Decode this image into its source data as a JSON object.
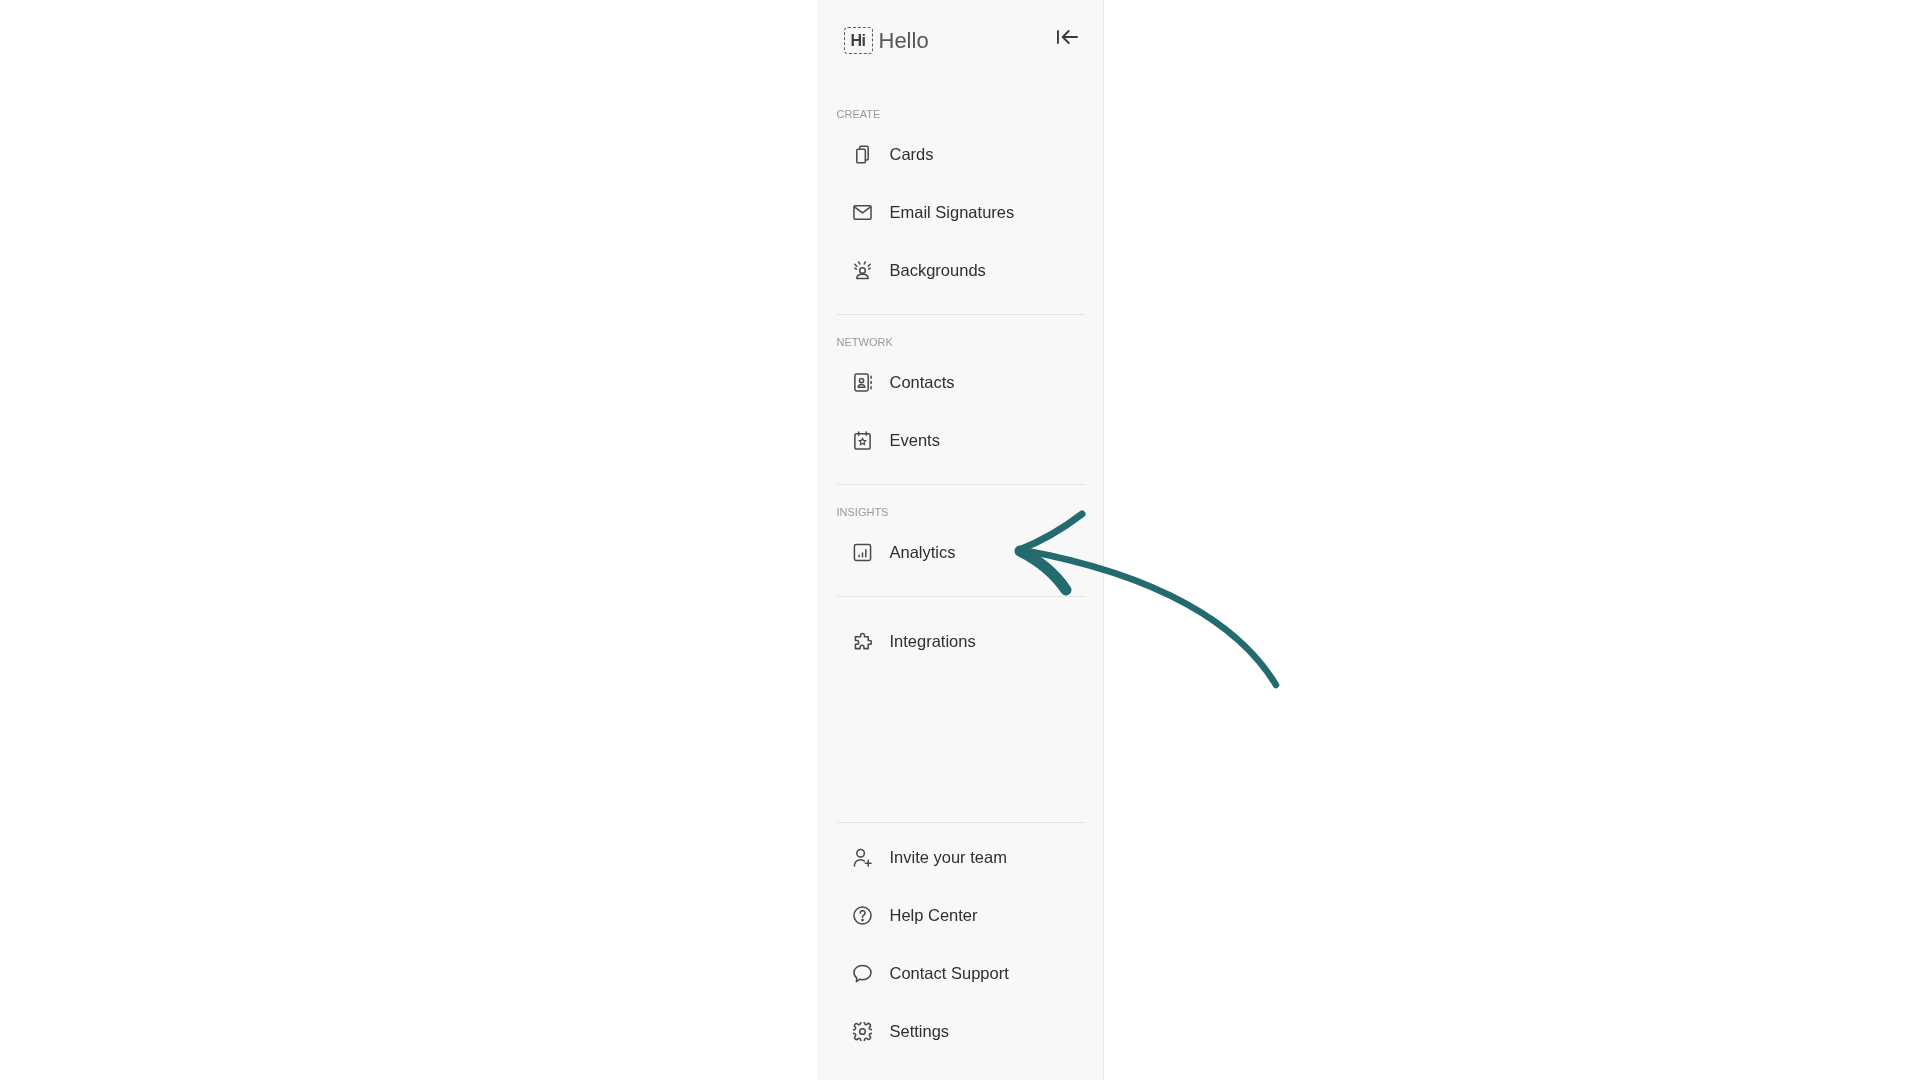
{
  "sidebar": {
    "logo": {
      "mark": "Hi",
      "name": "Hello"
    },
    "sections": [
      {
        "heading": "CREATE",
        "items": [
          {
            "label": "Cards",
            "selected": false
          },
          {
            "label": "Email Signatures",
            "selected": false
          },
          {
            "label": "Backgrounds",
            "selected": false
          }
        ]
      },
      {
        "heading": "NETWORK",
        "items": [
          {
            "label": "Contacts",
            "selected": false
          },
          {
            "label": "Events",
            "selected": false
          }
        ]
      },
      {
        "heading": "INSIGHTS",
        "items": [
          {
            "label": "Analytics",
            "selected": false
          }
        ]
      },
      {
        "items": [
          {
            "label": "Integrations",
            "selected": false
          }
        ]
      }
    ],
    "footer_items": [
      {
        "label": "Invite your team",
        "selected": false
      },
      {
        "label": "Help Center",
        "selected": false
      },
      {
        "label": "Contact Support",
        "selected": false
      },
      {
        "label": "Settings",
        "selected": false
      }
    ]
  },
  "annotations": [
    {
      "kind": "arrow"
    }
  ]
}
